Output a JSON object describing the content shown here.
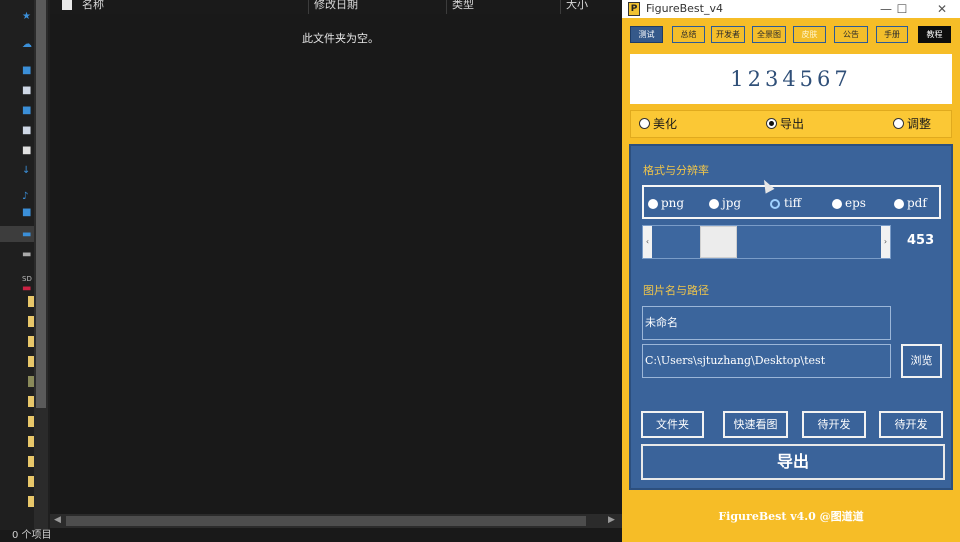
{
  "explorer": {
    "columns": {
      "name": "名称",
      "modified": "修改日期",
      "type": "类型",
      "size": "大小"
    },
    "empty_message": "此文件夹为空。",
    "status": "0 个项目"
  },
  "app": {
    "title": "FigureBest_v4",
    "window_controls": {
      "minimize": "—",
      "maximize": "☐",
      "close": "✕"
    },
    "menu": [
      "测试",
      "总结",
      "开发者",
      "全景图",
      "皮肤",
      "公告",
      "手册",
      "教程"
    ],
    "number_display": "1234567",
    "modes": [
      {
        "label": "美化",
        "checked": false
      },
      {
        "label": "导出",
        "checked": true
      },
      {
        "label": "调整",
        "checked": false
      }
    ],
    "format_section": {
      "title": "格式与分辨率",
      "formats": [
        {
          "label": "png",
          "selected": false
        },
        {
          "label": "jpg",
          "selected": false
        },
        {
          "label": "tiff",
          "selected": true
        },
        {
          "label": "eps",
          "selected": false
        },
        {
          "label": "pdf",
          "selected": false
        }
      ],
      "resolution": 453,
      "slider_fraction": 0.25,
      "arrow_left": "‹",
      "arrow_right": "›"
    },
    "path_section": {
      "title": "图片名与路径",
      "filename": "未命名",
      "path": "C:\\Users\\sjtuzhang\\Desktop\\test",
      "browse_label": "浏览"
    },
    "actions": [
      "文件夹",
      "快速看图",
      "待开发",
      "待开发"
    ],
    "export_label": "导出",
    "footer": "FigureBest v4.0 @图道道"
  },
  "colors": {
    "window_bg": "#f6bd27",
    "panel_bg": "#3a639a",
    "accent_text": "#f1c64a",
    "display_text": "#2f4f78"
  }
}
